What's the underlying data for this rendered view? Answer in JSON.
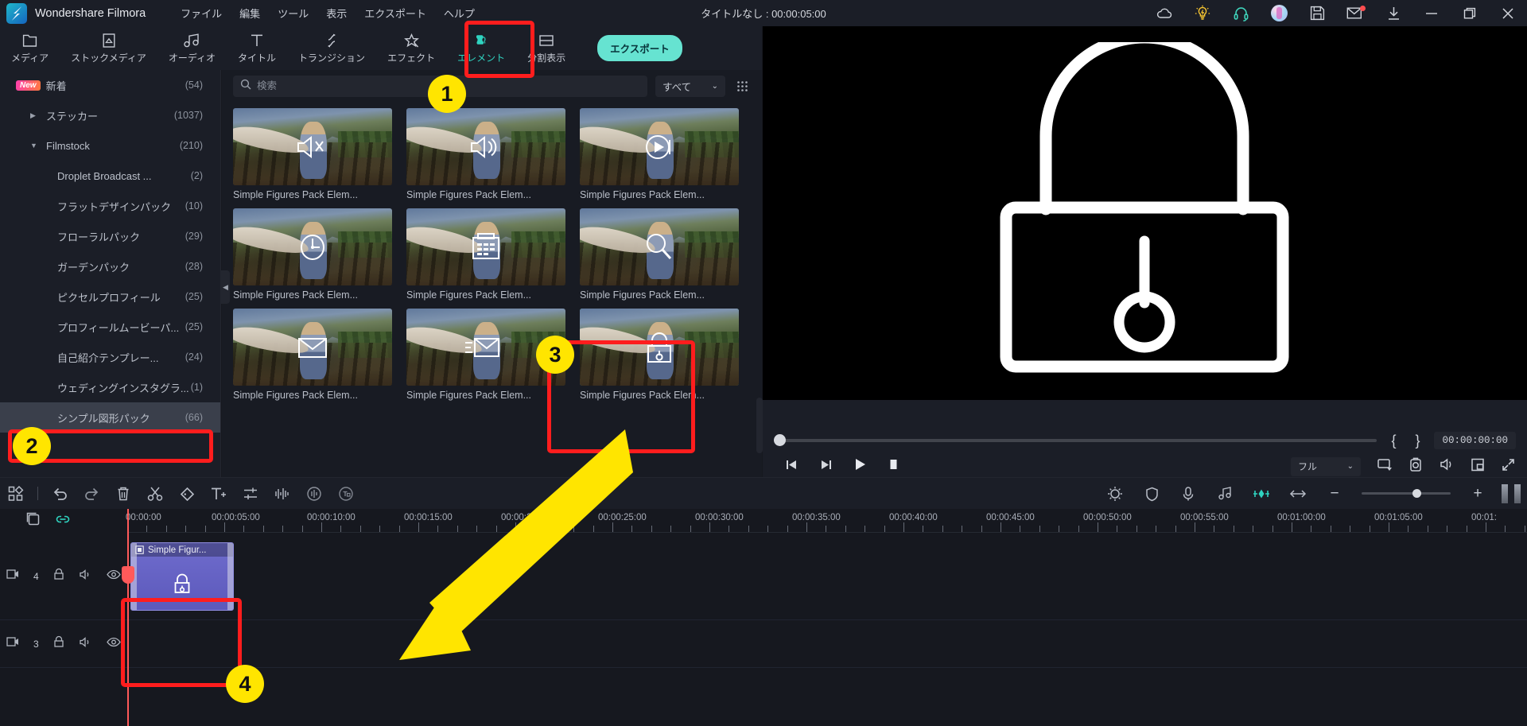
{
  "app": {
    "name": "Wondershare Filmora",
    "document_title": "タイトルなし : 00:00:05:00"
  },
  "menubar": [
    "ファイル",
    "編集",
    "ツール",
    "表示",
    "エクスポート",
    "ヘルプ"
  ],
  "titlebar_icons": [
    "cloud-icon",
    "lightbulb-icon",
    "headset-icon",
    "avatar",
    "save-icon",
    "mail-icon",
    "download-icon",
    "minimize-button",
    "maximize-button",
    "close-button"
  ],
  "tabs": [
    {
      "label": "メディア",
      "icon": "media-icon",
      "active": false
    },
    {
      "label": "ストックメディア",
      "icon": "stock-media-icon",
      "active": false
    },
    {
      "label": "オーディオ",
      "icon": "audio-icon",
      "active": false
    },
    {
      "label": "タイトル",
      "icon": "title-icon",
      "active": false
    },
    {
      "label": "トランジション",
      "icon": "transition-icon",
      "active": false
    },
    {
      "label": "エフェクト",
      "icon": "effect-icon",
      "active": false
    },
    {
      "label": "エレメント",
      "icon": "element-icon",
      "active": true
    },
    {
      "label": "分割表示",
      "icon": "split-screen-icon",
      "active": false
    }
  ],
  "export_button": "エクスポート",
  "sidebar": {
    "items": [
      {
        "label": "新着",
        "count": "(54)",
        "level": 0,
        "badge": "New",
        "caret": "",
        "selected": false
      },
      {
        "label": "ステッカー",
        "count": "(1037)",
        "level": 0,
        "badge": "",
        "caret": "▶",
        "selected": false
      },
      {
        "label": "Filmstock",
        "count": "(210)",
        "level": 0,
        "badge": "",
        "caret": "▼",
        "selected": false
      },
      {
        "label": "Droplet Broadcast ...",
        "count": "(2)",
        "level": 1,
        "badge": "",
        "caret": "",
        "selected": false
      },
      {
        "label": "フラットデザインパック",
        "count": "(10)",
        "level": 1,
        "badge": "",
        "caret": "",
        "selected": false
      },
      {
        "label": "フローラルパック",
        "count": "(29)",
        "level": 1,
        "badge": "",
        "caret": "",
        "selected": false
      },
      {
        "label": "ガーデンパック",
        "count": "(28)",
        "level": 1,
        "badge": "",
        "caret": "",
        "selected": false
      },
      {
        "label": "ピクセルプロフィール",
        "count": "(25)",
        "level": 1,
        "badge": "",
        "caret": "",
        "selected": false
      },
      {
        "label": "プロフィールムービーパ...",
        "count": "(25)",
        "level": 1,
        "badge": "",
        "caret": "",
        "selected": false
      },
      {
        "label": "自己紹介テンプレー...",
        "count": "(24)",
        "level": 1,
        "badge": "",
        "caret": "",
        "selected": false
      },
      {
        "label": "ウェディングインスタグラ...",
        "count": "(1)",
        "level": 1,
        "badge": "",
        "caret": "",
        "selected": false
      },
      {
        "label": "シンプル図形パック",
        "count": "(66)",
        "level": 1,
        "badge": "",
        "caret": "",
        "selected": true
      }
    ]
  },
  "browser": {
    "search": {
      "placeholder": "検索",
      "value": ""
    },
    "filter": {
      "value": "すべて"
    },
    "view_toggle_icon": "grid-view-icon",
    "items": [
      {
        "caption": "Simple Figures Pack Elem...",
        "icon": "speaker-mute-icon",
        "selected": false
      },
      {
        "caption": "Simple Figures Pack Elem...",
        "icon": "speaker-on-icon",
        "selected": false
      },
      {
        "caption": "Simple Figures Pack Elem...",
        "icon": "play-circle-icon",
        "selected": false
      },
      {
        "caption": "Simple Figures Pack Elem...",
        "icon": "clock-icon",
        "selected": false
      },
      {
        "caption": "Simple Figures Pack Elem...",
        "icon": "calendar-icon",
        "selected": false
      },
      {
        "caption": "Simple Figures Pack Elem...",
        "icon": "magnifier-icon",
        "selected": false
      },
      {
        "caption": "Simple Figures Pack Elem...",
        "icon": "envelope-icon",
        "selected": false
      },
      {
        "caption": "Simple Figures Pack Elem...",
        "icon": "send-mail-icon",
        "selected": false
      },
      {
        "caption": "Simple Figures Pack Elem...",
        "icon": "padlock-icon",
        "selected": true
      }
    ]
  },
  "preview": {
    "overlay_graphic": "padlock-graphic",
    "timecode": "00:00:00:00",
    "mark_in": "{",
    "mark_out": "}",
    "quality": "フル",
    "controls": [
      "prev-frame-button",
      "next-frame-button",
      "play-button",
      "stop-button"
    ],
    "right_controls": [
      "snapshot-to-timeline-icon",
      "camera-snapshot-icon",
      "volume-icon",
      "picture-in-picture-icon",
      "fullscreen-icon"
    ]
  },
  "timeline_toolbar": {
    "icons": [
      "templates-icon",
      "undo-icon",
      "redo-icon",
      "delete-icon",
      "split-scissors-icon",
      "marker-icon",
      "add-text-icon",
      "adjust-icon",
      "audio-waveform-icon",
      "audio-ducking-icon",
      "auto-reframe-icon"
    ],
    "right_icons": [
      "color-wheel-icon",
      "mask-icon",
      "voiceover-icon",
      "audio-mixer-icon",
      "keyframe-icon",
      "fit-timeline-icon"
    ],
    "zoom_out": "−",
    "zoom_in": "+"
  },
  "timeline": {
    "head_icons": [
      "add-track-icon",
      "link-icon"
    ],
    "ruler_ticks": [
      "00:00:00",
      "00:00:05:00",
      "00:00:10:00",
      "00:00:15:00",
      "00:00:20:00",
      "00:00:25:00",
      "00:00:30:00",
      "00:00:35:00",
      "00:00:40:00",
      "00:00:45:00",
      "00:00:50:00",
      "00:00:55:00",
      "00:01:00:00",
      "00:01:05:00",
      "00:01:"
    ],
    "tracks": [
      {
        "number": "4",
        "clip_label": "Simple Figur...",
        "clip_icon": "padlock-icon",
        "has_clip": true
      },
      {
        "number": "3",
        "clip_label": "",
        "clip_icon": "",
        "has_clip": false
      }
    ],
    "track_icons": [
      "video-track-icon",
      "lock-icon",
      "mute-icon",
      "eye-icon"
    ]
  },
  "annotations": [
    {
      "number": "1",
      "target": "element-tab"
    },
    {
      "number": "2",
      "target": "sidebar-item-simple-figures-pack"
    },
    {
      "number": "3",
      "target": "browser-item-padlock"
    },
    {
      "number": "4",
      "target": "timeline-clip"
    }
  ],
  "colors": {
    "accent_teal": "#2fd3c0",
    "annotation_red": "#ff1d1d",
    "annotation_yellow": "#ffe500",
    "playhead_red": "#ff5a5a",
    "clip_purple": "#6f6ccd"
  }
}
